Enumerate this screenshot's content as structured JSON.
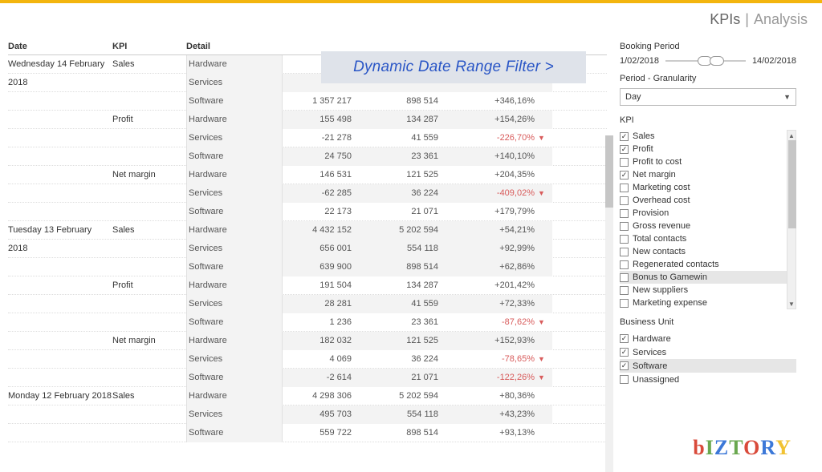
{
  "header": {
    "kpis": "KPIs",
    "sep": "|",
    "analysis": "Analysis"
  },
  "callout": "Dynamic Date Range Filter >",
  "columns": {
    "date": "Date",
    "kpi": "KPI",
    "detail": "Detail"
  },
  "rows": [
    {
      "date": "Wednesday 14 February 2018",
      "kpi": "Sales",
      "detail": "Hardware",
      "v1": "",
      "v2": "",
      "chg": "",
      "arrow": "",
      "neg": false,
      "shade": false
    },
    {
      "date": "",
      "kpi": "",
      "detail": "Services",
      "v1": "",
      "v2": "",
      "chg": "",
      "arrow": "",
      "neg": false,
      "shade": true
    },
    {
      "date": "",
      "kpi": "",
      "detail": "Software",
      "v1": "1 357 217",
      "v2": "898 514",
      "chg": "+346,16%",
      "arrow": "",
      "neg": false,
      "shade": false
    },
    {
      "date": "",
      "kpi": "Profit",
      "detail": "Hardware",
      "v1": "155 498",
      "v2": "134 287",
      "chg": "+154,26%",
      "arrow": "",
      "neg": false,
      "shade": true
    },
    {
      "date": "",
      "kpi": "",
      "detail": "Services",
      "v1": "-21 278",
      "v2": "41 559",
      "chg": "-226,70%",
      "arrow": "▼",
      "neg": true,
      "shade": false
    },
    {
      "date": "",
      "kpi": "",
      "detail": "Software",
      "v1": "24 750",
      "v2": "23 361",
      "chg": "+140,10%",
      "arrow": "",
      "neg": false,
      "shade": true
    },
    {
      "date": "",
      "kpi": "Net margin",
      "detail": "Hardware",
      "v1": "146 531",
      "v2": "121 525",
      "chg": "+204,35%",
      "arrow": "",
      "neg": false,
      "shade": false
    },
    {
      "date": "",
      "kpi": "",
      "detail": "Services",
      "v1": "-62 285",
      "v2": "36 224",
      "chg": "-409,02%",
      "arrow": "▼",
      "neg": true,
      "shade": true
    },
    {
      "date": "",
      "kpi": "",
      "detail": "Software",
      "v1": "22 173",
      "v2": "21 071",
      "chg": "+179,79%",
      "arrow": "",
      "neg": false,
      "shade": false
    },
    {
      "date": "Tuesday 13 February 2018",
      "kpi": "Sales",
      "detail": "Hardware",
      "v1": "4 432 152",
      "v2": "5 202 594",
      "chg": "+54,21%",
      "arrow": "",
      "neg": false,
      "shade": true
    },
    {
      "date": "",
      "kpi": "",
      "detail": "Services",
      "v1": "656 001",
      "v2": "554 118",
      "chg": "+92,99%",
      "arrow": "",
      "neg": false,
      "shade": false
    },
    {
      "date": "",
      "kpi": "",
      "detail": "Software",
      "v1": "639 900",
      "v2": "898 514",
      "chg": "+62,86%",
      "arrow": "",
      "neg": false,
      "shade": true
    },
    {
      "date": "",
      "kpi": "Profit",
      "detail": "Hardware",
      "v1": "191 504",
      "v2": "134 287",
      "chg": "+201,42%",
      "arrow": "",
      "neg": false,
      "shade": false
    },
    {
      "date": "",
      "kpi": "",
      "detail": "Services",
      "v1": "28 281",
      "v2": "41 559",
      "chg": "+72,33%",
      "arrow": "",
      "neg": false,
      "shade": true
    },
    {
      "date": "",
      "kpi": "",
      "detail": "Software",
      "v1": "1 236",
      "v2": "23 361",
      "chg": "-87,62%",
      "arrow": "▼",
      "neg": true,
      "shade": false
    },
    {
      "date": "",
      "kpi": "Net margin",
      "detail": "Hardware",
      "v1": "182 032",
      "v2": "121 525",
      "chg": "+152,93%",
      "arrow": "",
      "neg": false,
      "shade": true
    },
    {
      "date": "",
      "kpi": "",
      "detail": "Services",
      "v1": "4 069",
      "v2": "36 224",
      "chg": "-78,65%",
      "arrow": "▼",
      "neg": true,
      "shade": false
    },
    {
      "date": "",
      "kpi": "",
      "detail": "Software",
      "v1": "-2 614",
      "v2": "21 071",
      "chg": "-122,26%",
      "arrow": "▼",
      "neg": true,
      "shade": true
    },
    {
      "date": "Monday 12 February 2018",
      "kpi": "Sales",
      "detail": "Hardware",
      "v1": "4 298 306",
      "v2": "5 202 594",
      "chg": "+80,36%",
      "arrow": "",
      "neg": false,
      "shade": false
    },
    {
      "date": "",
      "kpi": "",
      "detail": "Services",
      "v1": "495 703",
      "v2": "554 118",
      "chg": "+43,23%",
      "arrow": "",
      "neg": false,
      "shade": true
    },
    {
      "date": "",
      "kpi": "",
      "detail": "Software",
      "v1": "559 722",
      "v2": "898 514",
      "chg": "+93,13%",
      "arrow": "",
      "neg": false,
      "shade": false
    }
  ],
  "side": {
    "booking_label": "Booking Period",
    "booking_start": "1/02/2018",
    "booking_end": "14/02/2018",
    "gran_label": "Period - Granularity",
    "gran_value": "Day",
    "kpi_label": "KPI",
    "kpi_items": [
      {
        "label": "Sales",
        "checked": true,
        "hl": false
      },
      {
        "label": "Profit",
        "checked": true,
        "hl": false
      },
      {
        "label": "Profit to cost",
        "checked": false,
        "hl": false
      },
      {
        "label": "Net margin",
        "checked": true,
        "hl": false
      },
      {
        "label": "Marketing cost",
        "checked": false,
        "hl": false
      },
      {
        "label": "Overhead cost",
        "checked": false,
        "hl": false
      },
      {
        "label": "Provision",
        "checked": false,
        "hl": false
      },
      {
        "label": "Gross revenue",
        "checked": false,
        "hl": false
      },
      {
        "label": "Total contacts",
        "checked": false,
        "hl": false
      },
      {
        "label": "New contacts",
        "checked": false,
        "hl": false
      },
      {
        "label": "Regenerated contacts",
        "checked": false,
        "hl": false
      },
      {
        "label": "Bonus to Gamewin",
        "checked": false,
        "hl": true
      },
      {
        "label": "New suppliers",
        "checked": false,
        "hl": false
      },
      {
        "label": "Marketing expense",
        "checked": false,
        "hl": false
      }
    ],
    "bu_label": "Business Unit",
    "bu_items": [
      {
        "label": "Hardware",
        "checked": true,
        "hl": false
      },
      {
        "label": "Services",
        "checked": true,
        "hl": false
      },
      {
        "label": "Software",
        "checked": true,
        "hl": true
      },
      {
        "label": "Unassigned",
        "checked": false,
        "hl": false
      }
    ]
  },
  "logo": {
    "b": "b",
    "i": "I",
    "z": "Z",
    "t": "T",
    "o": "O",
    "r": "R",
    "y": "Y"
  }
}
